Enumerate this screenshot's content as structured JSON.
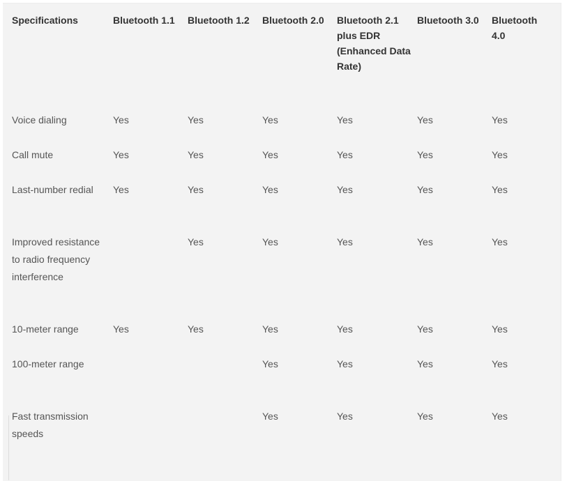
{
  "table": {
    "headers": [
      "Specifications",
      "Bluetooth 1.1",
      "Bluetooth 1.2",
      "Bluetooth 2.0",
      "Bluetooth 2.1 plus EDR (Enhanced Data Rate)",
      "Bluetooth 3.0",
      "Bluetooth 4.0"
    ],
    "rows": [
      {
        "feature": "Voice dialing",
        "values": [
          "Yes",
          "Yes",
          "Yes",
          "Yes",
          "Yes",
          "Yes"
        ]
      },
      {
        "feature": "Call mute",
        "values": [
          "Yes",
          "Yes",
          "Yes",
          "Yes",
          "Yes",
          "Yes"
        ]
      },
      {
        "feature": "Last-number redial",
        "values": [
          "Yes",
          "Yes",
          "Yes",
          "Yes",
          "Yes",
          "Yes"
        ]
      },
      {
        "feature": "Improved resistance to radio frequency interference",
        "values": [
          "",
          "Yes",
          "Yes",
          "Yes",
          "Yes",
          "Yes"
        ]
      },
      {
        "feature": "10-meter range",
        "values": [
          "Yes",
          "Yes",
          "Yes",
          "Yes",
          "Yes",
          "Yes"
        ]
      },
      {
        "feature": "100-meter range",
        "values": [
          "",
          "",
          "Yes",
          "Yes",
          "Yes",
          "Yes"
        ]
      },
      {
        "feature": "Fast transmission speeds",
        "values": [
          "",
          "",
          "Yes",
          "Yes",
          "Yes",
          "Yes"
        ]
      }
    ]
  }
}
